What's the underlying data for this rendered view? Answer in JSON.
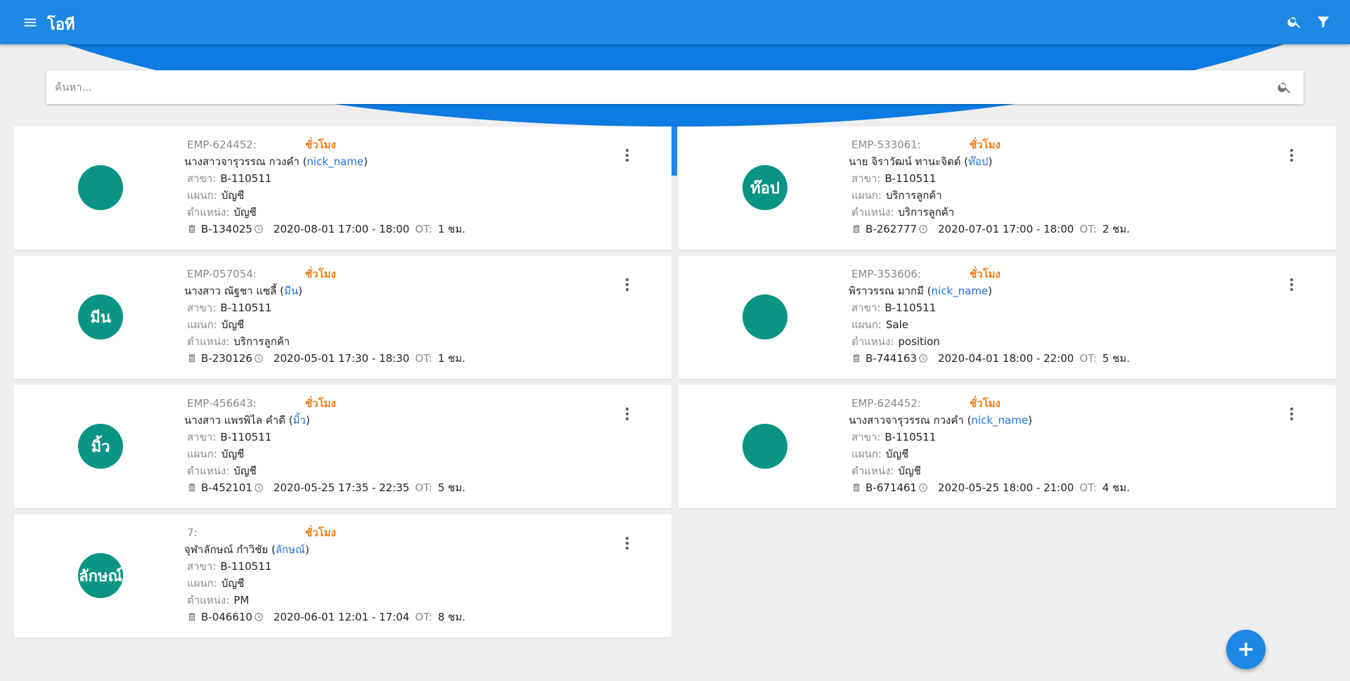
{
  "app": {
    "title": "โอที"
  },
  "search": {
    "placeholder": "ค้นหา..."
  },
  "labels": {
    "branch": "สาขา:",
    "department": "แผนก:",
    "position": "ตำแหน่ง:",
    "ot": "OT:"
  },
  "cards": [
    {
      "emp_id": "EMP-624452:",
      "ot_type": "ชั่วโมง",
      "name": "นางสาวจารุวรรณ กวงคำ",
      "nickname": "nick_name",
      "avatar_text": "",
      "branch": "B-110511",
      "department": "บัญชี",
      "position": "บัญชี",
      "doc_no": "B-134025",
      "period": "2020-08-01 17:00 - 18:00",
      "ot_hours": "1 ชม."
    },
    {
      "emp_id": "EMP-533061:",
      "ot_type": "ชั่วโมง",
      "name": "นาย จิราวัฒน์ ทานะจิตต์",
      "nickname": "ท๊อป",
      "avatar_text": "ท๊อป",
      "branch": "B-110511",
      "department": "บริการลูกค้า",
      "position": "บริการลูกค้า",
      "doc_no": "B-262777",
      "period": "2020-07-01 17:00 - 18:00",
      "ot_hours": "2 ชม."
    },
    {
      "emp_id": "EMP-057054:",
      "ot_type": "ชั่วโมง",
      "name": "นางสาว ณัฐชา แซลี้",
      "nickname": "มีน",
      "avatar_text": "มีน",
      "branch": "B-110511",
      "department": "บัญชี",
      "position": "บริการลูกค้า",
      "doc_no": "B-230126",
      "period": "2020-05-01 17:30 - 18:30",
      "ot_hours": "1 ชม."
    },
    {
      "emp_id": "EMP-353606:",
      "ot_type": "ชั่วโมง",
      "name": "พิราวรรณ มากมี",
      "nickname": "nick_name",
      "avatar_text": "",
      "branch": "B-110511",
      "department": "Sale",
      "position": "position",
      "doc_no": "B-744163",
      "period": "2020-04-01 18:00 - 22:00",
      "ot_hours": "5 ชม."
    },
    {
      "emp_id": "EMP-456643:",
      "ot_type": "ชั่วโมง",
      "name": "นางสาว แพรพิไล คำดี",
      "nickname": "มิ้ว",
      "avatar_text": "มิ้ว",
      "branch": "B-110511",
      "department": "บัญชี",
      "position": "บัญชี",
      "doc_no": "B-452101",
      "period": "2020-05-25 17:35 - 22:35",
      "ot_hours": "5 ชม."
    },
    {
      "emp_id": "EMP-624452:",
      "ot_type": "ชั่วโมง",
      "name": "นางสาวจารุวรรณ กวงคำ",
      "nickname": "nick_name",
      "avatar_text": "",
      "branch": "B-110511",
      "department": "บัญชี",
      "position": "บัญชี",
      "doc_no": "B-671461",
      "period": "2020-05-25 18:00 - 21:00",
      "ot_hours": "4 ชม."
    },
    {
      "emp_id": "7:",
      "ot_type": "ชั่วโมง",
      "name": "จุฬาลักษณ์ กำวิชัย",
      "nickname": "ลักษณ์",
      "avatar_text": "ลักษณ์",
      "branch": "B-110511",
      "department": "บัญชี",
      "position": "PM",
      "doc_no": "B-046610",
      "period": "2020-06-01 12:01 - 17:04",
      "ot_hours": "8 ชม."
    }
  ],
  "colors": {
    "appbar": "#1e88e5",
    "hero": "#0d7be1",
    "avatar": "#0a9484",
    "ot_type": "#f37a12",
    "nickname": "#1e6fd9",
    "fab": "#1e88e5"
  },
  "icons": {
    "menu": "menu-icon",
    "appbar_search": "search-icon",
    "filter": "filter-icon",
    "field_search": "search-icon",
    "document": "clipboard-icon",
    "time": "clock-icon",
    "more": "more-vert-icon",
    "add": "plus-icon"
  }
}
